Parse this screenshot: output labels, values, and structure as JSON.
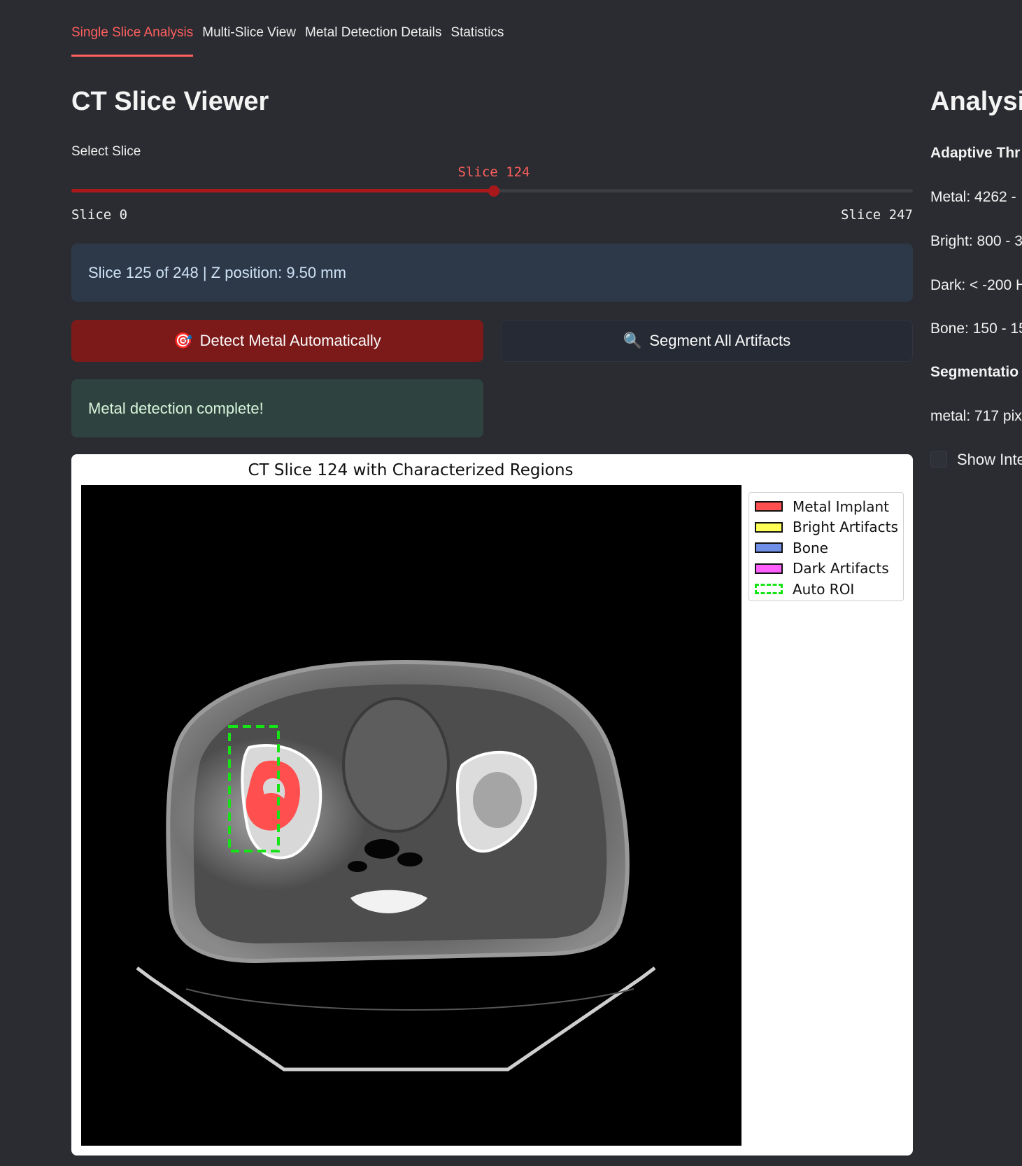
{
  "tabs": [
    {
      "label": "Single Slice Analysis",
      "active": true
    },
    {
      "label": "Multi-Slice View",
      "active": false
    },
    {
      "label": "Metal Detection Details",
      "active": false
    },
    {
      "label": "Statistics",
      "active": false
    }
  ],
  "viewer": {
    "title": "CT Slice Viewer",
    "slider_label": "Select Slice",
    "slider_value_text": "Slice 124",
    "slider_min_text": "Slice 0",
    "slider_max_text": "Slice 247",
    "slider_value": 124,
    "slider_min": 0,
    "slider_max": 247,
    "info_text": "Slice 125 of 248 | Z position: 9.50 mm",
    "detect_button_icon": "🎯",
    "detect_button_label": "Detect Metal Automatically",
    "segment_button_icon": "🔍",
    "segment_button_label": "Segment All Artifacts",
    "success_text": "Metal detection complete!"
  },
  "figure": {
    "title": "CT Slice 124 with Characterized Regions",
    "legend": [
      {
        "label": "Metal Implant",
        "color": "#ff4f4f"
      },
      {
        "label": "Bright Artifacts",
        "color": "#ffff55"
      },
      {
        "label": "Bone",
        "color": "#6f8fe6"
      },
      {
        "label": "Dark Artifacts",
        "color": "#ff5fff"
      },
      {
        "label": "Auto ROI",
        "color": "#17e417"
      }
    ]
  },
  "analysis": {
    "title": "Analysis",
    "adaptive_heading": "Adaptive Thr",
    "lines": [
      "Metal: 4262 -",
      "Bright: 800 - 3",
      "Dark: < -200 H",
      "Bone: 150 - 15"
    ],
    "segmentation_heading": "Segmentatio",
    "seg_line": "metal: 717 pix",
    "checkbox_label": "Show Inte"
  },
  "colors": {
    "accent": "#ff5f5f",
    "primary_button": "#7c1a1a",
    "info_bg": "#2d3848",
    "success_bg": "#2e433f",
    "page_bg": "#2b2c31"
  }
}
